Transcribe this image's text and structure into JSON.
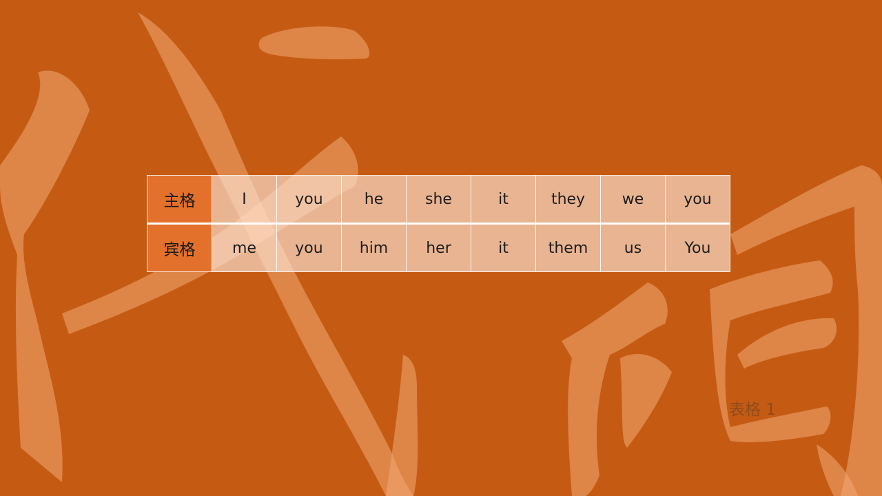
{
  "slide": {
    "background_color": "#c55b12",
    "accent_cell_color": "#e3702b",
    "watermark_color": "#f3a874"
  },
  "table": {
    "rows": [
      {
        "label": "主格",
        "cells": [
          "I",
          "you",
          "he",
          "she",
          "it",
          "they",
          "we",
          "you"
        ]
      },
      {
        "label": "宾格",
        "cells": [
          "me",
          "you",
          "him",
          "her",
          "it",
          "them",
          "us",
          "You"
        ]
      }
    ]
  },
  "caption": "表格 1"
}
